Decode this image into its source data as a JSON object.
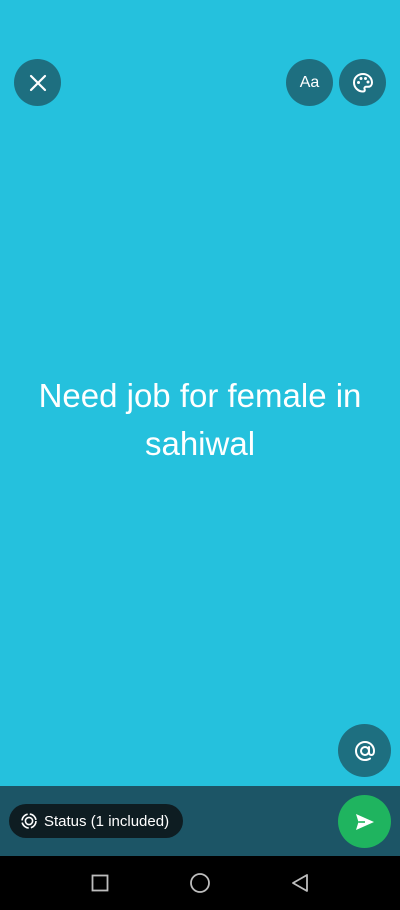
{
  "status": {
    "text": "Need job for female in sahiwal",
    "background_color": "#25c1dd"
  },
  "toolbar": {
    "close_icon": "close-icon",
    "font_label": "Aa",
    "palette_icon": "palette-icon"
  },
  "mention_icon": "at-sign-icon",
  "bottom_bar": {
    "audience_label": "Status (1 included)",
    "audience_icon": "status-ring-icon",
    "send_icon": "send-icon",
    "send_color": "#1fb45f"
  },
  "nav": {
    "recents_icon": "square-icon",
    "home_icon": "circle-icon",
    "back_icon": "triangle-back-icon"
  }
}
